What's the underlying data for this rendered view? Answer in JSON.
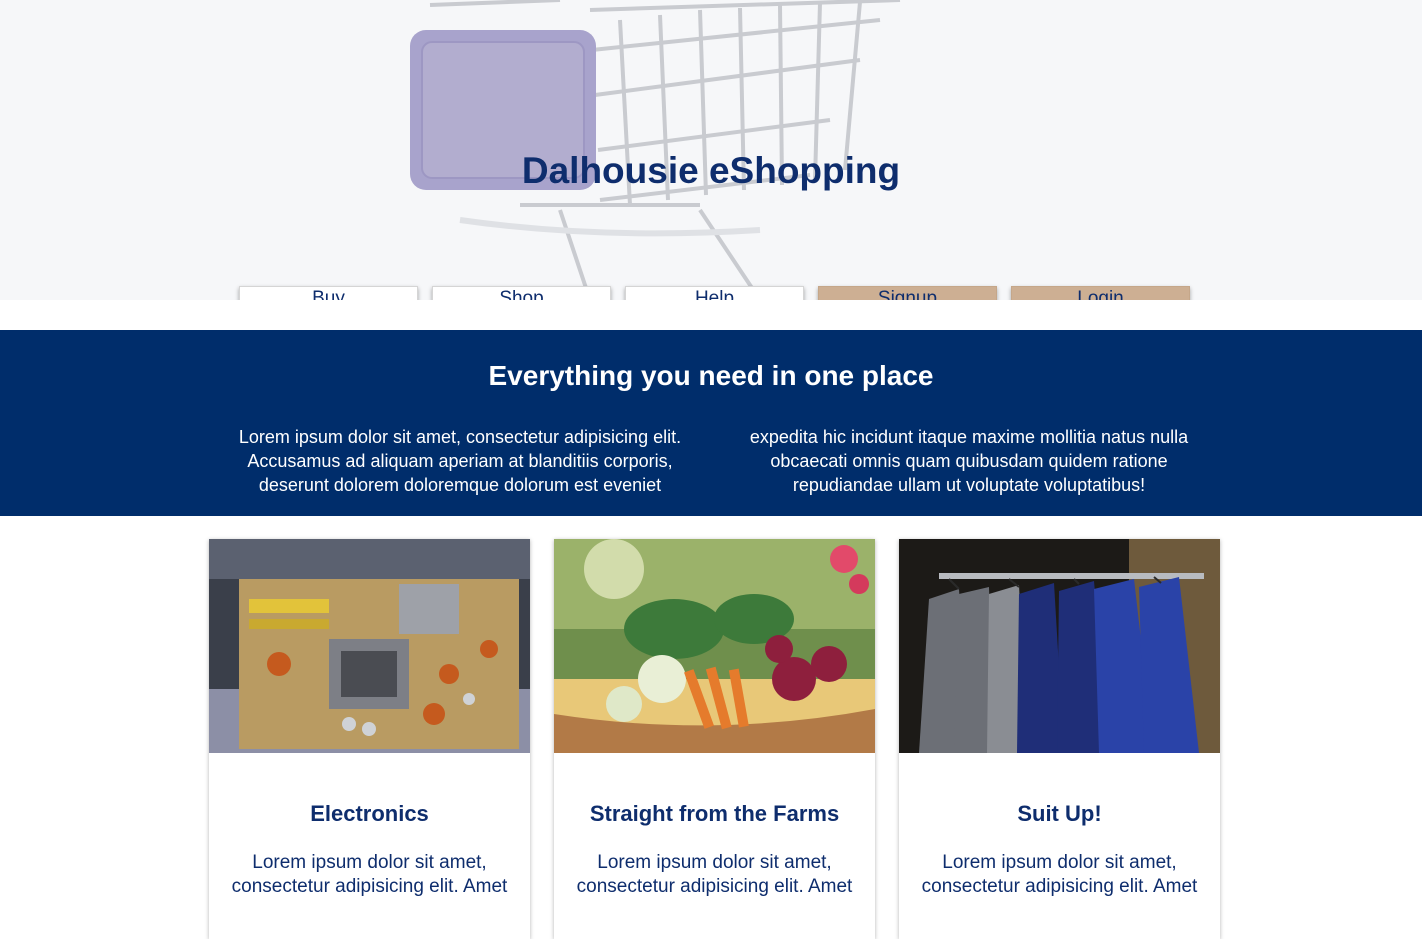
{
  "header": {
    "title": "Dalhousie eShopping",
    "hero_image": "shopping-cart-photo"
  },
  "nav": {
    "buy": "Buy",
    "shop": "Shop",
    "help": "Help",
    "signup": "Signup",
    "login": "Login"
  },
  "banner": {
    "title": "Everything you need in one place",
    "left_text": "Lorem ipsum dolor sit amet, consectetur adipisicing elit. Accusamus ad aliquam aperiam at blanditiis corporis, deserunt dolorem doloremque dolorum est eveniet",
    "right_text": "expedita hic incidunt itaque maxime mollitia natus nulla obcaecati omnis quam quibusdam quidem ratione repudiandae ullam ut voluptate voluptatibus!"
  },
  "cards": [
    {
      "title": "Electronics",
      "text": "Lorem ipsum dolor sit amet, consectetur adipisicing elit. Amet",
      "image": "circuit-board-photo"
    },
    {
      "title": "Straight from the Farms",
      "text": "Lorem ipsum dolor sit amet, consectetur adipisicing elit. Amet",
      "image": "vegetable-basket-photo"
    },
    {
      "title": "Suit Up!",
      "text": "Lorem ipsum dolor sit amet, consectetur adipisicing elit. Amet",
      "image": "suits-on-rack-photo"
    }
  ],
  "colors": {
    "brand_navy": "#002d6b",
    "text_navy": "#0e2d6d",
    "accent_tan": "#cdaf93"
  }
}
